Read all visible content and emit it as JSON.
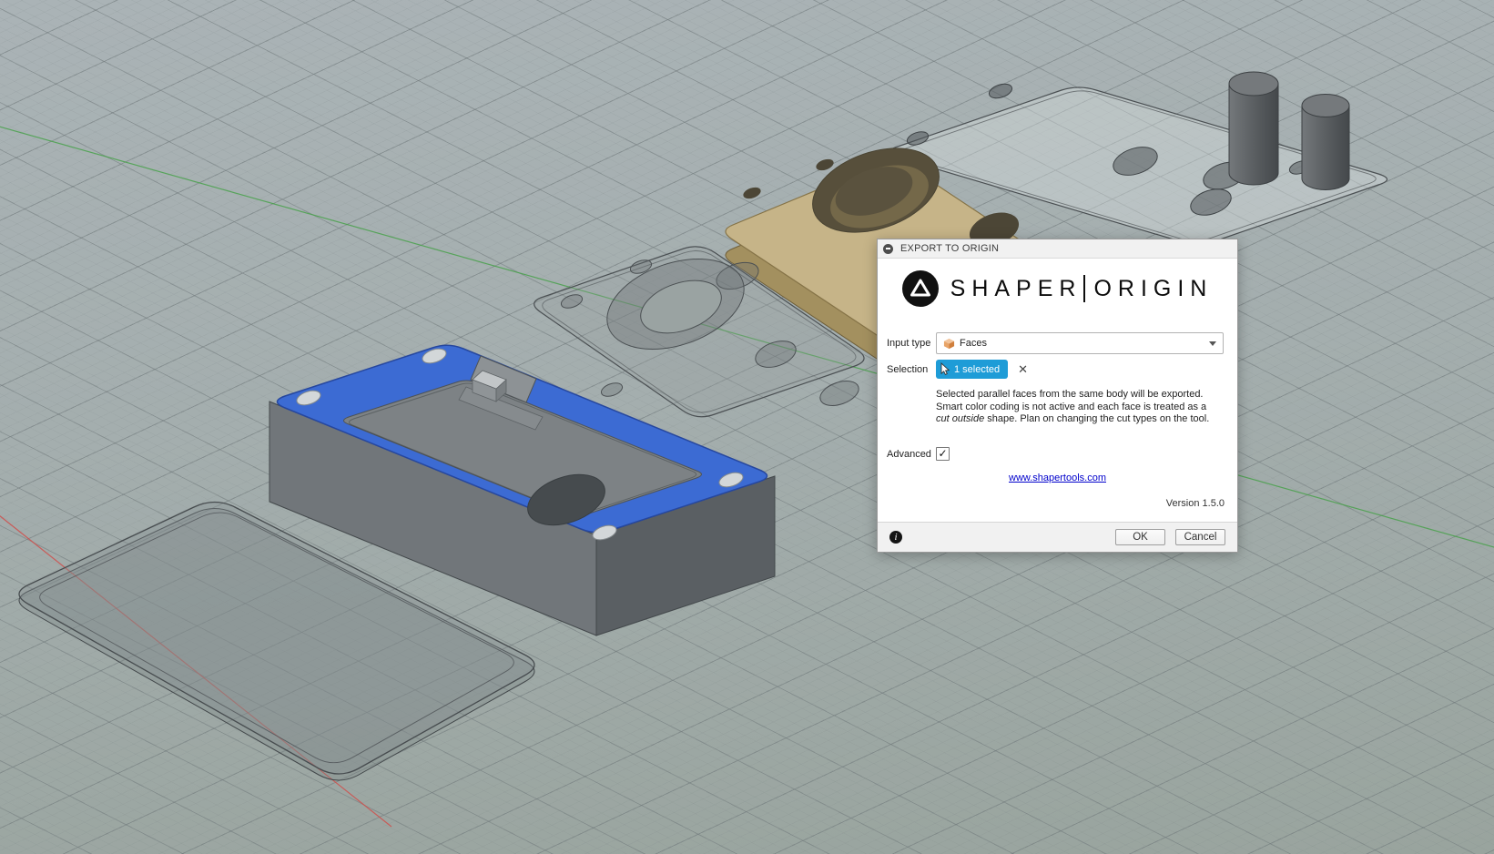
{
  "dialog": {
    "title": "EXPORT TO ORIGIN",
    "logo": {
      "left": "SHAPER",
      "right": "ORIGIN"
    },
    "input_type": {
      "label": "Input type",
      "value": "Faces"
    },
    "selection": {
      "label": "Selection",
      "badge": "1 selected",
      "clear_glyph": "✕"
    },
    "help": {
      "part1": "Selected parallel faces from the same body will be exported. Smart color coding is not active and each face is treated as a ",
      "italic": "cut outside",
      "part2": " shape. Plan on changing the cut types on the tool."
    },
    "advanced": {
      "label": "Advanced",
      "checked": true,
      "check_glyph": "✓"
    },
    "link": "www.shapertools.com",
    "version": "Version 1.5.0",
    "footer": {
      "ok": "OK",
      "cancel": "Cancel",
      "info_glyph": "i"
    }
  },
  "colors": {
    "selection_face": "#3c6bd3",
    "selection_badge": "#1e9cd7",
    "link_blue": "#0000cc",
    "tan_plate": "#c6b488"
  }
}
